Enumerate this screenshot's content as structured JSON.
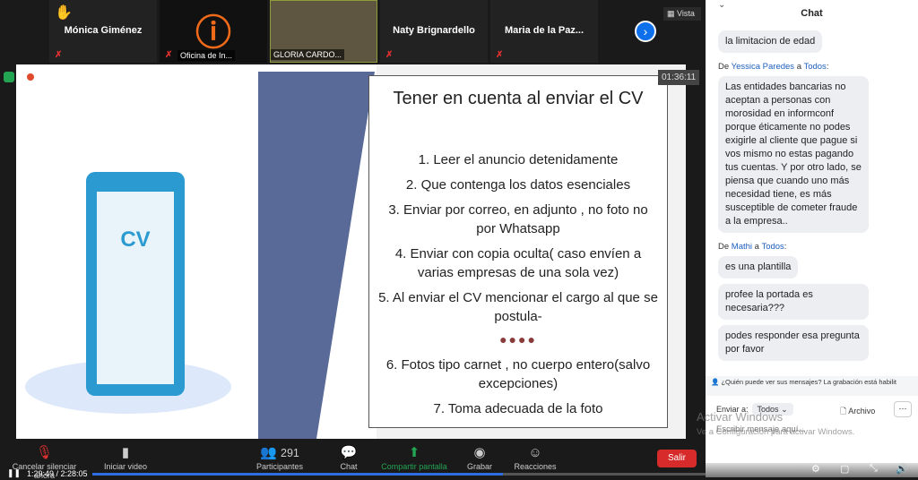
{
  "participants": [
    {
      "name": "Mónica Giménez",
      "hand": true
    },
    {
      "name": "Oficina de In..."
    },
    {
      "name": "GLORIA CARDO..."
    },
    {
      "name": "Naty Brignardello"
    },
    {
      "name": "Maria de  la Paz..."
    }
  ],
  "view_label": "Vista",
  "timer": "01:36:11",
  "slide": {
    "cv_label": "CV",
    "title": "Tener en cuenta al enviar el  CV",
    "items": [
      "1. Leer el anuncio detenidamente",
      "2. Que contenga los datos esenciales",
      "3. Enviar  por correo, en adjunto , no foto no por Whatsapp",
      "4. Enviar con copia oculta( caso envíen a varias empresas de una sola vez)",
      "5. Al enviar el CV  mencionar el cargo al que se postula-"
    ],
    "dots": "●●●●",
    "items2": [
      "6. Fotos tipo carnet , no cuerpo entero(salvo excepciones)",
      "7.  Toma adecuada de la foto"
    ]
  },
  "toolbar": {
    "unmute": "Cancelar silenciar ahora",
    "video": "Iniciar video",
    "participants": "Participantes",
    "participant_count": "291",
    "chat": "Chat",
    "share": "Compartir pantalla",
    "record": "Grabar",
    "reactions": "Reacciones",
    "leave": "Salir"
  },
  "playback": {
    "time": "1:29:49 / 2:28:05",
    "progress": 0.67
  },
  "chat": {
    "title": "Chat",
    "m0": "la limitacion de edad",
    "from1": {
      "prefix": "De",
      "sender": "Yessica Paredes",
      "mid": "a",
      "to": "Todos",
      "colon": ":"
    },
    "m1": "Las entidades bancarias no aceptan a personas con morosidad en informconf porque éticamente no podes exigirle al cliente que pague si vos mismo no estas pagando tus cuentas. Y por otro lado, se piensa que cuando uno más necesidad tiene, es más susceptible de cometer fraude a la empresa..",
    "from2": {
      "prefix": "De",
      "sender": "Mathi",
      "mid": "a",
      "to": "Todos",
      "colon": ":"
    },
    "m2": "es una plantilla",
    "m3": "profee la portada es necesaria???",
    "m4": "podes responder esa pregunta por favor",
    "who_notice": "¿Quién puede ver sus mensajes? La grabación está habilit",
    "send_to_label": "Enviar a:",
    "send_to_value": "Todos",
    "file_label": "Archivo",
    "more": "···",
    "placeholder": "Escribir mensaje aquí..."
  },
  "watermark": {
    "line1": "Activar Windows",
    "line2": "Ve a Configuración para activar Windows."
  },
  "colors": {
    "accent": "#0e71eb",
    "leave": "#d72a2a",
    "share": "#23a453",
    "sender": "#1e5fbf"
  }
}
